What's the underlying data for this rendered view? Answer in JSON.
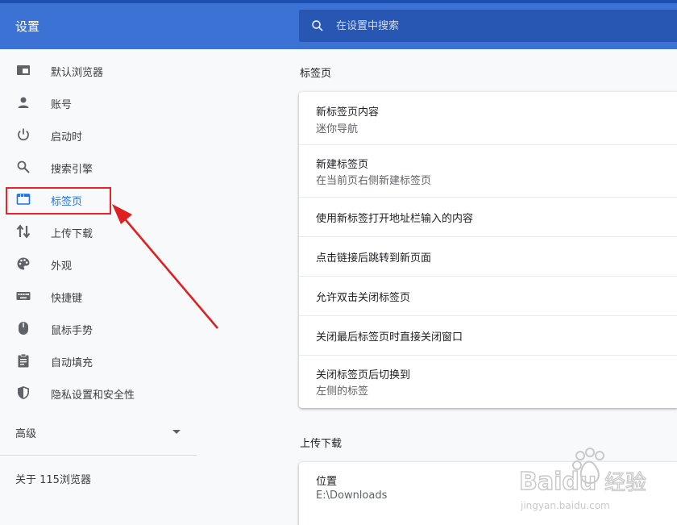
{
  "header": {
    "title": "设置",
    "search_placeholder": "在设置中搜索"
  },
  "sidebar": {
    "items": [
      {
        "label": "默认浏览器",
        "icon": "browser-window-icon"
      },
      {
        "label": "账号",
        "icon": "person-icon"
      },
      {
        "label": "启动时",
        "icon": "power-icon"
      },
      {
        "label": "搜索引擎",
        "icon": "search-icon"
      },
      {
        "label": "标签页",
        "icon": "tab-icon",
        "active": true
      },
      {
        "label": "上传下载",
        "icon": "up-down-arrows-icon"
      },
      {
        "label": "外观",
        "icon": "palette-icon"
      },
      {
        "label": "快捷键",
        "icon": "keyboard-icon"
      },
      {
        "label": "鼠标手势",
        "icon": "mouse-icon"
      },
      {
        "label": "自动填充",
        "icon": "clipboard-icon"
      },
      {
        "label": "隐私设置和安全性",
        "icon": "shield-icon"
      }
    ],
    "advanced_label": "高级",
    "about_label": "关于 115浏览器"
  },
  "sections": [
    {
      "title": "标签页",
      "rows": [
        {
          "title": "新标签页内容",
          "subtitle": "迷你导航"
        },
        {
          "title": "新建标签页",
          "subtitle": "在当前页右侧新建标签页"
        },
        {
          "title": "使用新标签打开地址栏输入的内容"
        },
        {
          "title": "点击链接后跳转到新页面"
        },
        {
          "title": "允许双击关闭标签页"
        },
        {
          "title": "关闭最后标签页时直接关闭窗口"
        },
        {
          "title": "关闭标签页后切换到",
          "subtitle": "左侧的标签"
        }
      ]
    },
    {
      "title": "上传下载",
      "rows": [
        {
          "title": "位置",
          "subtitle": "E:\\Downloads"
        }
      ]
    }
  ],
  "watermark": {
    "brand": "Baidu",
    "brand_cn": "经验",
    "url": "jingyan.baidu.com"
  },
  "colors": {
    "header_bg": "#3d72d5",
    "search_bg": "#2756b3",
    "active": "#1a73e8",
    "annotation": "#e8232a"
  }
}
